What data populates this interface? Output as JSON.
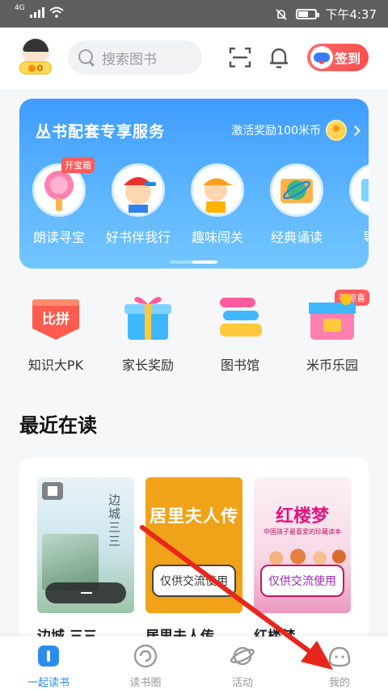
{
  "status_bar": {
    "network": "4G",
    "time": "下午4:37"
  },
  "header": {
    "coin_count": "0",
    "search_placeholder": "搜索图书",
    "signin_label": "签到"
  },
  "banner": {
    "title": "丛书配套专享服务",
    "reward_text": "激活奖励100米币",
    "services": [
      {
        "label": "朗读寻宝",
        "tag": "开宝箱"
      },
      {
        "label": "好书伴我行"
      },
      {
        "label": "趣味闯关"
      },
      {
        "label": "经典诵读"
      },
      {
        "label": "导读"
      }
    ]
  },
  "quick_links": [
    {
      "label": "知识大PK",
      "icon_text": "比拼"
    },
    {
      "label": "家长奖励"
    },
    {
      "label": "图书馆"
    },
    {
      "label": "米币乐园",
      "tag": "有惊喜"
    }
  ],
  "recent": {
    "title": "最近在读",
    "books": [
      {
        "title": "边城 三三",
        "cover_title": "边城 三三"
      },
      {
        "title": "居里夫人传",
        "cover_title": "居里夫人传",
        "stamp": "仅供交流使用"
      },
      {
        "title": "红楼梦",
        "cover_title": "红楼梦",
        "cover_sub": "中国孩子最喜爱的珍藏读本",
        "stamp": "仅供交流使用"
      }
    ]
  },
  "bottom_nav": [
    {
      "label": "一起读书",
      "active": true
    },
    {
      "label": "读书圈"
    },
    {
      "label": "活动"
    },
    {
      "label": "我的"
    }
  ],
  "colors": {
    "brand_blue": "#2d8cf0",
    "banner_blue": "#3f9cff",
    "signin_red": "#ff5b5b",
    "annotation_arrow": "#e8261b"
  }
}
